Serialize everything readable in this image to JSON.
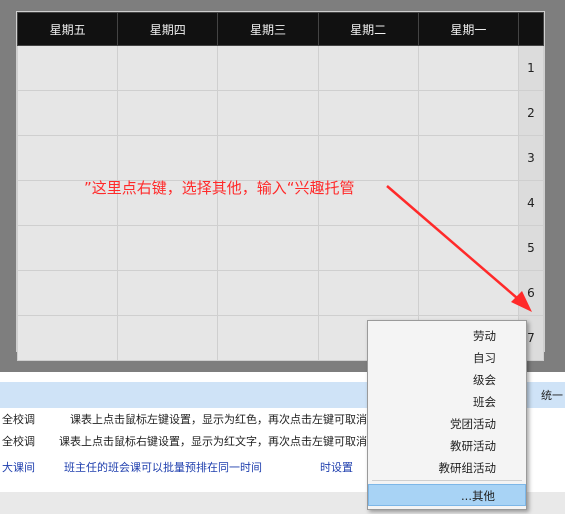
{
  "timetable": {
    "days": [
      "星期五",
      "星期四",
      "星期三",
      "星期二",
      "星期一"
    ],
    "periods": [
      "1",
      "2",
      "3",
      "4",
      "5",
      "6",
      "7"
    ]
  },
  "annotation": {
    "text": "这里点右键，选择其他，输入“兴趣托管”",
    "color": "#ff2a2a"
  },
  "panel": {
    "band_label": "统一",
    "notes": [
      "全校调",
      "课表上点击鼠标左键设置，显示为红色，再次点击左键可取消",
      "全校调",
      "课表上点击鼠标右键设置，显示为红文字，再次点击左键可取消",
      "大课间",
      "班主任的班会课可以批量预排在同一时间",
      "时设置"
    ]
  },
  "context_menu": {
    "items": [
      "劳动",
      "自习",
      "级会",
      "班会",
      "党团活动",
      "教研活动",
      "教研组活动"
    ],
    "selected_item": "其他...",
    "selected_color": "#a8d3f5"
  }
}
